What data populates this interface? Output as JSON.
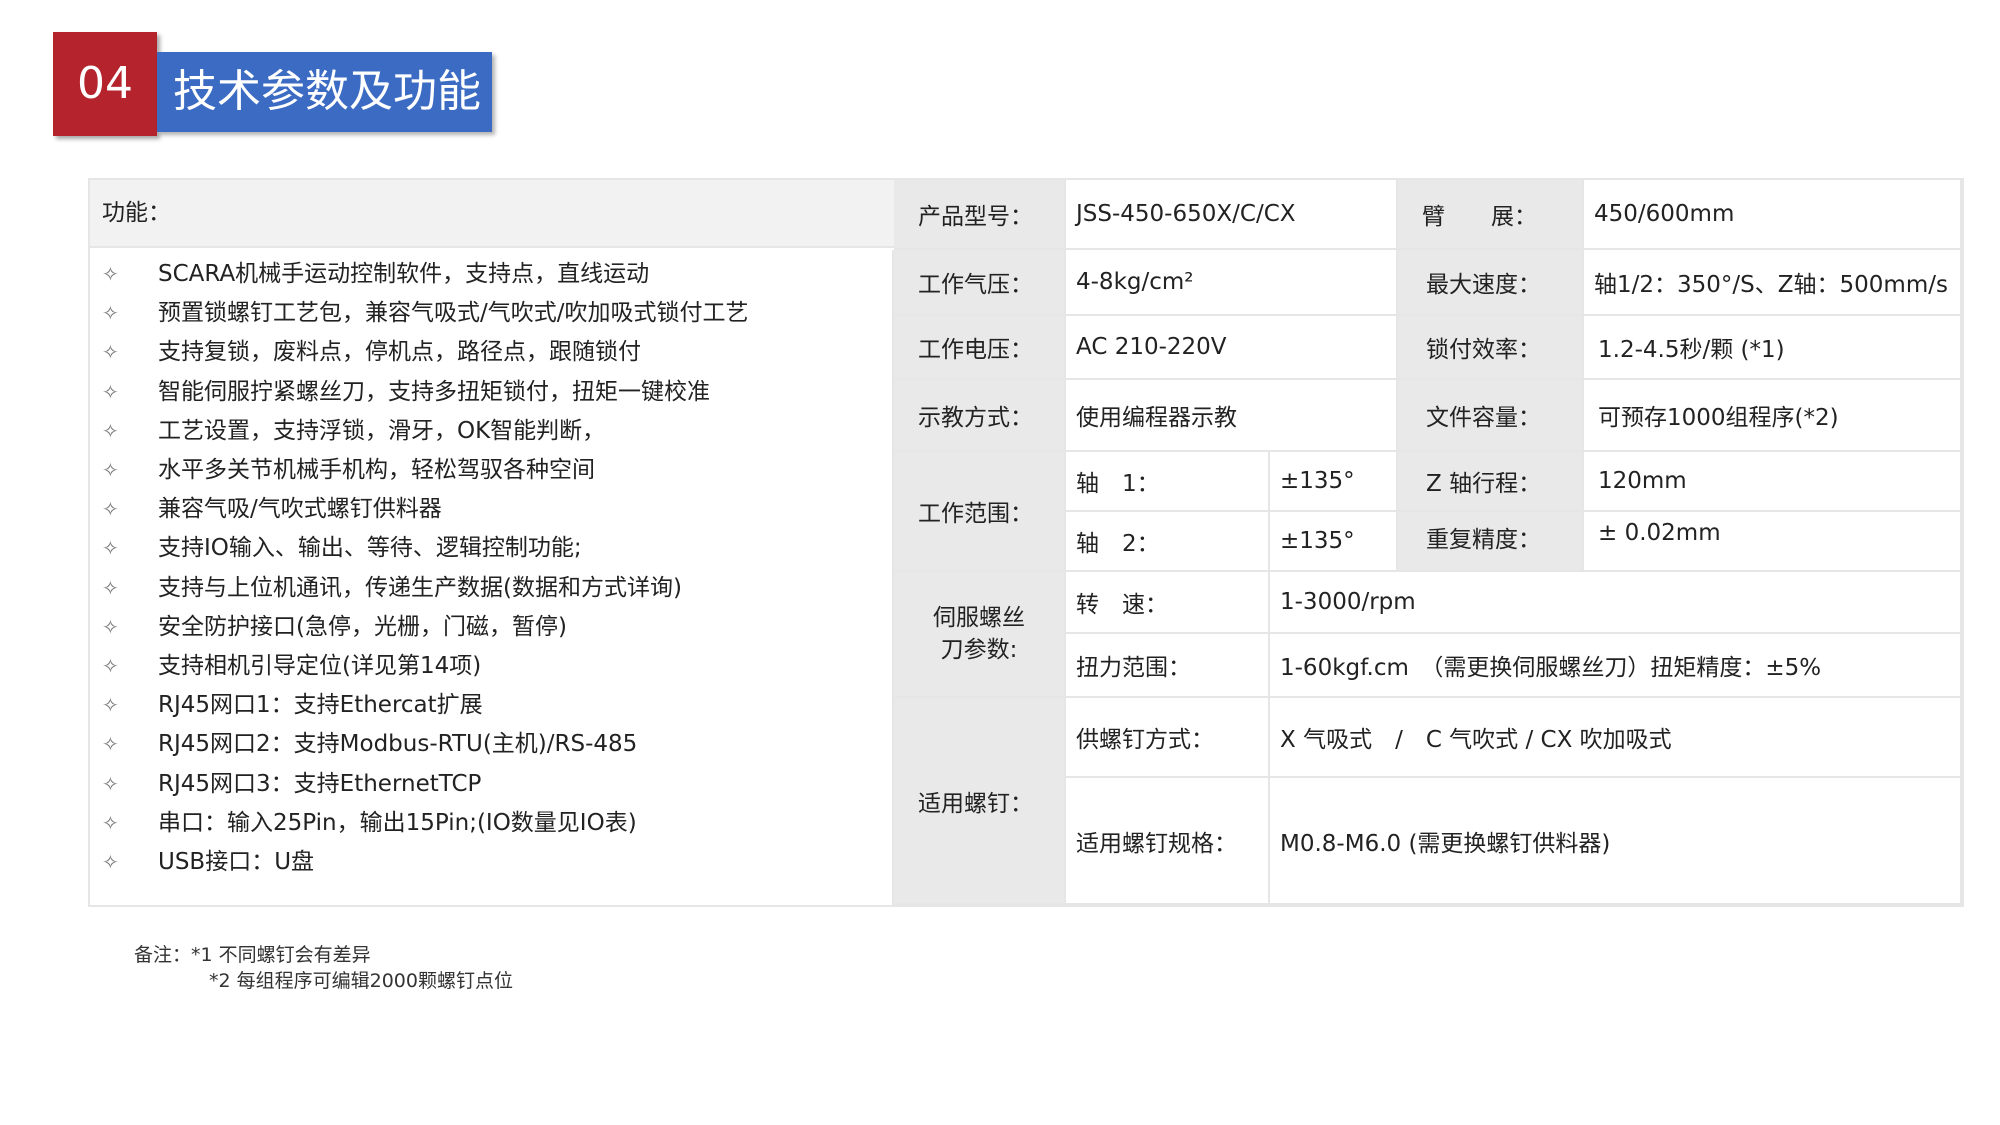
{
  "header": {
    "number": "04",
    "title": "技术参数及功能"
  },
  "functions": {
    "heading": "功能：",
    "bullet_icon": "four-point-star-outline-icon",
    "items": [
      "SCARA机械手运动控制软件，支持点，直线运动",
      "预置锁螺钉工艺包，兼容气吸式/气吹式/吹加吸式锁付工艺",
      "支持复锁，废料点，停机点，路径点，跟随锁付",
      "智能伺服拧紧螺丝刀，支持多扭矩锁付，扭矩一键校准",
      "工艺设置，支持浮锁，滑牙，OK智能判断，",
      "水平多关节机械手机构，轻松驾驭各种空间",
      "兼容气吸/气吹式螺钉供料器",
      "支持IO输入、输出、等待、逻辑控制功能;",
      "支持与上位机通讯，传递生产数据(数据和方式详询)",
      "安全防护接口(急停，光栅，门磁，暂停)",
      "支持相机引导定位(详见第14项)",
      "RJ45网口1：支持Ethercat扩展",
      "RJ45网口2：支持Modbus-RTU(主机)/RS-485",
      "RJ45网口3：支持EthernetTCP",
      "串口：输入25Pin，输出15Pin;(IO数量见IO表)",
      "USB接口：U盘"
    ]
  },
  "specs": {
    "model_label": "产品型号：",
    "model_value": "JSS-450-650X/C/CX",
    "arm_label": "臂　　展：",
    "arm_value": "450/600mm",
    "air_label": "工作气压：",
    "air_value": "4-8kg/cm²",
    "speed_label": "最大速度：",
    "speed_value": "轴1/2：350°/S、Z轴：500mm/s",
    "voltage_label": "工作电压：",
    "voltage_value": "AC 210-220V",
    "efficiency_label": "锁付效率：",
    "efficiency_value": "1.2-4.5秒/颗 (*1)",
    "teach_label": "示教方式：",
    "teach_value": "使用编程器示教",
    "file_label": "文件容量：",
    "file_value": "可预存1000组程序(*2)",
    "range_label": "工作范围：",
    "axis1_label": "轴　1：",
    "axis1_value": "±135°",
    "axis2_label": "轴　2：",
    "axis2_value": "±135°",
    "z_label": "Z 轴行程：",
    "z_value": "120mm",
    "repeat_label": "重复精度：",
    "repeat_value": "± 0.02mm",
    "servo_label": "伺服螺丝刀参数:",
    "rpm_label": "转　速：",
    "rpm_value": "1-3000/rpm",
    "torque_label": "扭力范围：",
    "torque_value": "1-60kgf.cm　（需更换伺服螺丝刀）扭矩精度：±5%",
    "screw_label": "适用螺钉：",
    "feed_label": "供螺钉方式：",
    "feed_value": "X 气吸式　/　C 气吹式 / CX 吹加吸式",
    "spec_label": "适用螺钉规格：",
    "spec_value": "M0.8-M6.0  (需更换螺钉供料器)"
  },
  "notes": {
    "line1": "备注：*1 不同螺钉会有差异",
    "line2": "*2 每组程序可编辑2000颗螺钉点位"
  }
}
